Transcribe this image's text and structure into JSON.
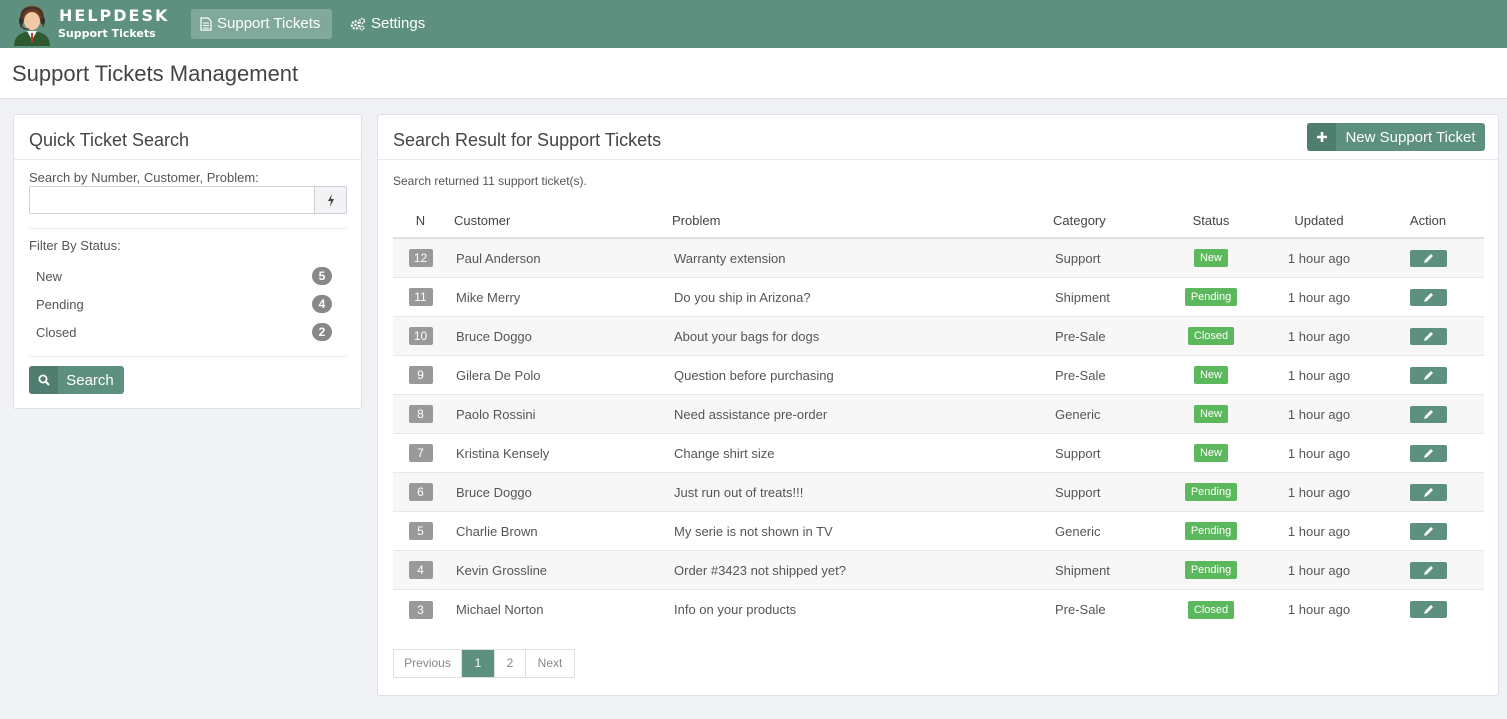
{
  "brand": {
    "title": "HELPDESK",
    "subtitle": "Support Tickets"
  },
  "nav": [
    {
      "label": "Support Tickets",
      "icon": "document-icon",
      "active": true
    },
    {
      "label": "Settings",
      "icon": "gears-icon",
      "active": false
    }
  ],
  "page_title": "Support Tickets Management",
  "quick_search": {
    "title": "Quick Ticket Search",
    "search_label": "Search by Number, Customer, Problem:",
    "search_value": "",
    "filter_label": "Filter By Status:",
    "filters": [
      {
        "label": "New",
        "count": "5"
      },
      {
        "label": "Pending",
        "count": "4"
      },
      {
        "label": "Closed",
        "count": "2"
      }
    ],
    "search_button": "Search"
  },
  "results": {
    "title": "Search Result for Support Tickets",
    "new_button": "New Support Ticket",
    "info": "Search returned 11 support ticket(s).",
    "columns": [
      "N",
      "Customer",
      "Problem",
      "Category",
      "Status",
      "Updated",
      "Action"
    ],
    "rows": [
      {
        "n": "12",
        "customer": "Paul Anderson",
        "problem": "Warranty extension",
        "category": "Support",
        "status": "New",
        "updated": "1 hour ago"
      },
      {
        "n": "11",
        "customer": "Mike Merry",
        "problem": "Do you ship in Arizona?",
        "category": "Shipment",
        "status": "Pending",
        "updated": "1 hour ago"
      },
      {
        "n": "10",
        "customer": "Bruce Doggo",
        "problem": "About your bags for dogs",
        "category": "Pre-Sale",
        "status": "Closed",
        "updated": "1 hour ago"
      },
      {
        "n": "9",
        "customer": "Gilera De Polo",
        "problem": "Question before purchasing",
        "category": "Pre-Sale",
        "status": "New",
        "updated": "1 hour ago"
      },
      {
        "n": "8",
        "customer": "Paolo Rossini",
        "problem": "Need assistance pre-order",
        "category": "Generic",
        "status": "New",
        "updated": "1 hour ago"
      },
      {
        "n": "7",
        "customer": "Kristina Kensely",
        "problem": "Change shirt size",
        "category": "Support",
        "status": "New",
        "updated": "1 hour ago"
      },
      {
        "n": "6",
        "customer": "Bruce Doggo",
        "problem": "Just run out of treats!!!",
        "category": "Support",
        "status": "Pending",
        "updated": "1 hour ago"
      },
      {
        "n": "5",
        "customer": "Charlie Brown",
        "problem": "My serie is not shown in TV",
        "category": "Generic",
        "status": "Pending",
        "updated": "1 hour ago"
      },
      {
        "n": "4",
        "customer": "Kevin Grossline",
        "problem": "Order #3423 not shipped yet?",
        "category": "Shipment",
        "status": "Pending",
        "updated": "1 hour ago"
      },
      {
        "n": "3",
        "customer": "Michael Norton",
        "problem": "Info on your products",
        "category": "Pre-Sale",
        "status": "Closed",
        "updated": "1 hour ago"
      }
    ],
    "pagination": [
      {
        "label": "Previous",
        "active": false
      },
      {
        "label": "1",
        "active": true
      },
      {
        "label": "2",
        "active": false
      },
      {
        "label": "Next",
        "active": false
      }
    ]
  },
  "colors": {
    "accent": "#5e9080",
    "status_green": "#5cb85c",
    "badge_gray": "#999999"
  }
}
